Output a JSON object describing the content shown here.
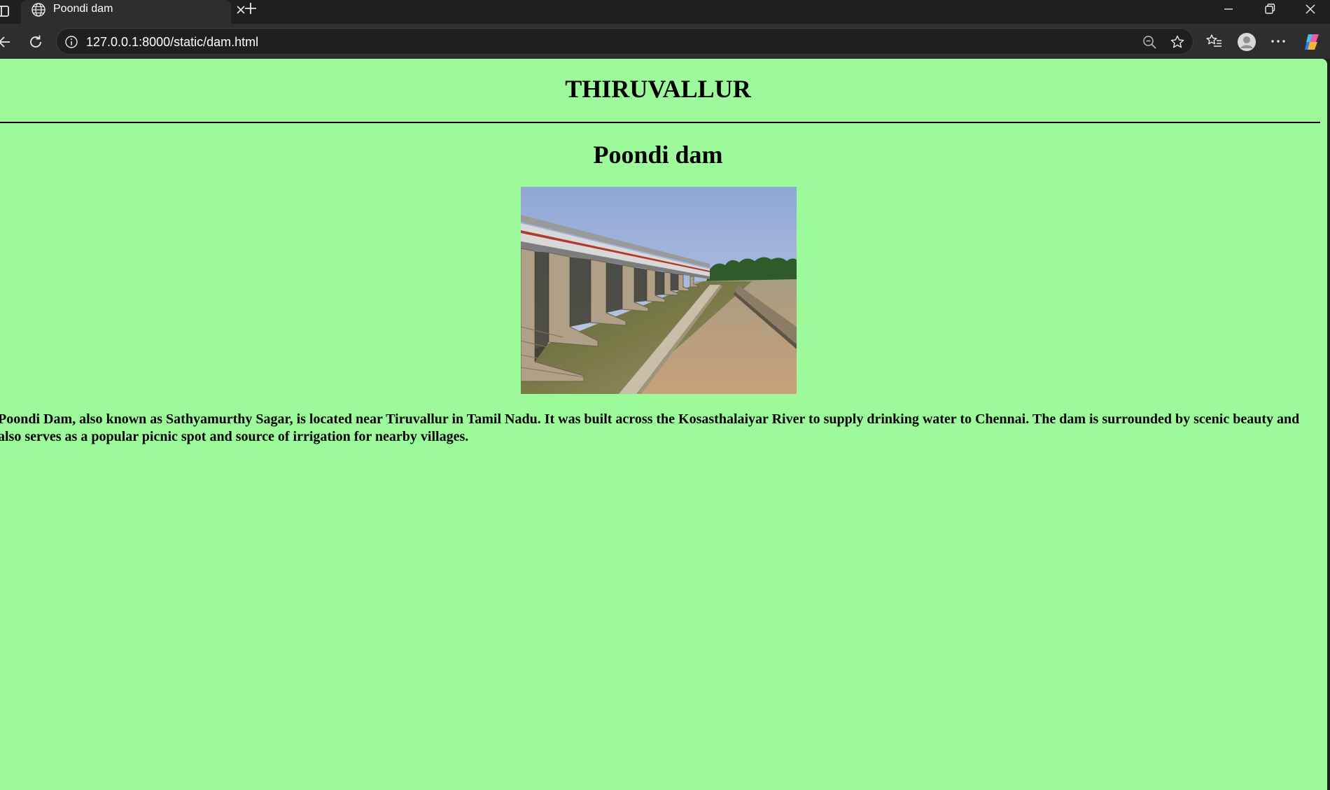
{
  "browser": {
    "tab": {
      "title": "Poondi dam",
      "favicon": "globe-icon"
    },
    "address_bar": {
      "url": "127.0.0.1:8000/static/dam.html"
    },
    "icons": [
      "sidebar-toggle-icon",
      "globe-icon",
      "close-icon",
      "plus-icon",
      "minimize-icon",
      "restore-icon",
      "close-window-icon",
      "back-icon",
      "reload-icon",
      "info-icon",
      "zoom-out-icon",
      "star-icon",
      "favorites-icon",
      "profile-icon",
      "more-icon",
      "copilot-icon"
    ]
  },
  "page": {
    "site_heading": "THIRUVALLUR",
    "title": "Poondi dam",
    "image": {
      "subject": "Poondi dam photo"
    },
    "description": "Poondi Dam, also known as Sathyamurthy Sagar, is located near Tiruvallur in Tamil Nadu. It was built across the Kosasthalaiyar River to supply drinking water to Chennai. The dam is surrounded by scenic beauty and also serves as a popular picnic spot and source of irrigation for nearby villages.",
    "background_color": "#9cfa9a"
  }
}
